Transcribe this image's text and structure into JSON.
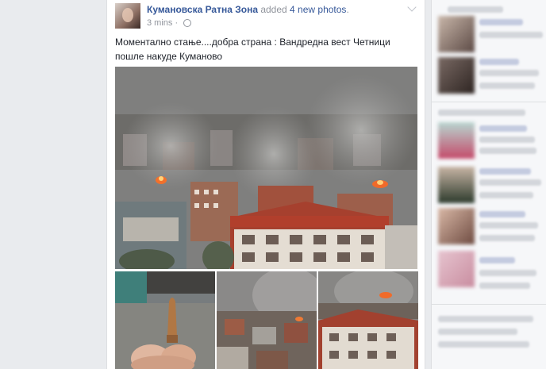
{
  "post": {
    "page_name": "Кумановска Ратна Зона",
    "action_prefix": " added ",
    "action_link": "4 new photos",
    "action_suffix": ".",
    "timestamp": "3 mins",
    "separator": " · ",
    "privacy_icon": "globe-icon",
    "text": "Моментално стање....добра страна : Вандредна вест Четници пошле накуде Куманово",
    "photos": [
      "main-photo",
      "bullet-photo",
      "town-smoke-photo",
      "rooftop-fire-photo"
    ]
  },
  "sidebar": {
    "note": "blurred, unreadable content"
  },
  "colors": {
    "page_bg": "#e9ebee",
    "link": "#365899",
    "meta": "#90949c"
  }
}
